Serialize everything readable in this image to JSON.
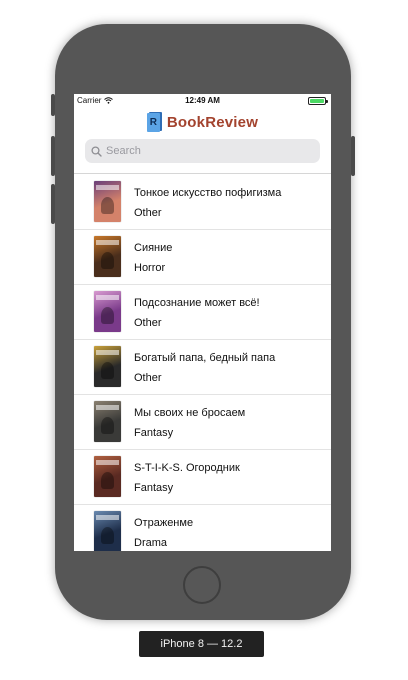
{
  "status_bar": {
    "carrier": "Carrier",
    "time": "12:49 AM",
    "battery_level": 1.0
  },
  "header": {
    "logo_letter": "R",
    "title": "BookReview"
  },
  "search": {
    "placeholder": "Search"
  },
  "books": [
    {
      "title": "Тонкое искусство пофигизма",
      "genre": "Other",
      "cover_color": "#d4826a",
      "cover_accent": "#6a3f7a"
    },
    {
      "title": "Сияние",
      "genre": "Horror",
      "cover_color": "#4a2e1c",
      "cover_accent": "#c8782a"
    },
    {
      "title": "Подсознание может всё!",
      "genre": "Other",
      "cover_color": "#7a3a8a",
      "cover_accent": "#d89ad0"
    },
    {
      "title": "Богатый папа, бедный папа",
      "genre": "Other",
      "cover_color": "#2a2a2a",
      "cover_accent": "#c9a13a"
    },
    {
      "title": "Мы своих не бросаем",
      "genre": "Fantasy",
      "cover_color": "#3a3a38",
      "cover_accent": "#8a8070"
    },
    {
      "title": "S-T-I-K-S. Огородник",
      "genre": "Fantasy",
      "cover_color": "#5a2a22",
      "cover_accent": "#b06040"
    },
    {
      "title": "Отраженме",
      "genre": "Drama",
      "cover_color": "#1e2e4a",
      "cover_accent": "#6a8ab0"
    }
  ],
  "device_label": "iPhone 8 — 12.2",
  "colors": {
    "title_brand": "#a3432e",
    "phone_body": "#565656"
  }
}
